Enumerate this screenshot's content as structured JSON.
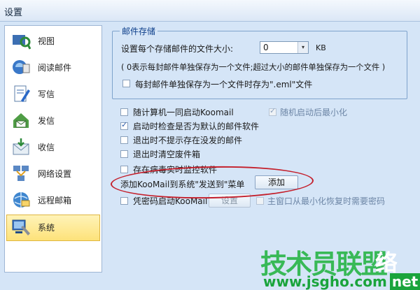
{
  "window": {
    "title": "设置"
  },
  "sidebar": {
    "items": [
      {
        "label": "视图",
        "icon": "view-icon"
      },
      {
        "label": "阅读邮件",
        "icon": "read-mail-icon"
      },
      {
        "label": "写信",
        "icon": "write-mail-icon"
      },
      {
        "label": "发信",
        "icon": "send-mail-icon"
      },
      {
        "label": "收信",
        "icon": "receive-mail-icon"
      },
      {
        "label": "网络设置",
        "icon": "network-icon"
      },
      {
        "label": "远程邮箱",
        "icon": "remote-mailbox-icon"
      },
      {
        "label": "系统",
        "icon": "system-icon"
      }
    ],
    "active_index": 7
  },
  "mail_storage": {
    "legend": "邮件存储",
    "size_label": "设置每个存储邮件的文件大小:",
    "size_value": "0",
    "size_unit": "KB",
    "note": "( 0表示每封邮件单独保存为一个文件;超过大小的邮件单独保存为一个文件 )",
    "separate_eml_label": "每封邮件单独保存为一个文件时存为\".eml\"文件"
  },
  "system": {
    "start_with_computer": "随计算机一同启动Koomail",
    "minimize_after_start": "随机启动后最小化",
    "check_default_client": "启动时检查是否为默认的邮件软件",
    "no_unsent_prompt": "退出时不提示存在没发的邮件",
    "empty_trash": "退出时清空废件箱",
    "antivirus_monitor": "存在病毒实时监控软件",
    "sendto_label": "添加KooMail到系统\"发送到\"菜单",
    "add_button": "添加",
    "password_start": "凭密码启动KooMail",
    "settings_button": "设置",
    "restore_password": "主窗口从最小化恢复时需要密码"
  },
  "watermark": {
    "line1": "技术员联盟",
    "line1_tail": "络",
    "line2": "www.jsgho.com",
    "line2_tail": "net"
  },
  "colors": {
    "accent": "#0c3e8a",
    "annotation": "#c41f2b",
    "watermark": "#2bb64a"
  }
}
